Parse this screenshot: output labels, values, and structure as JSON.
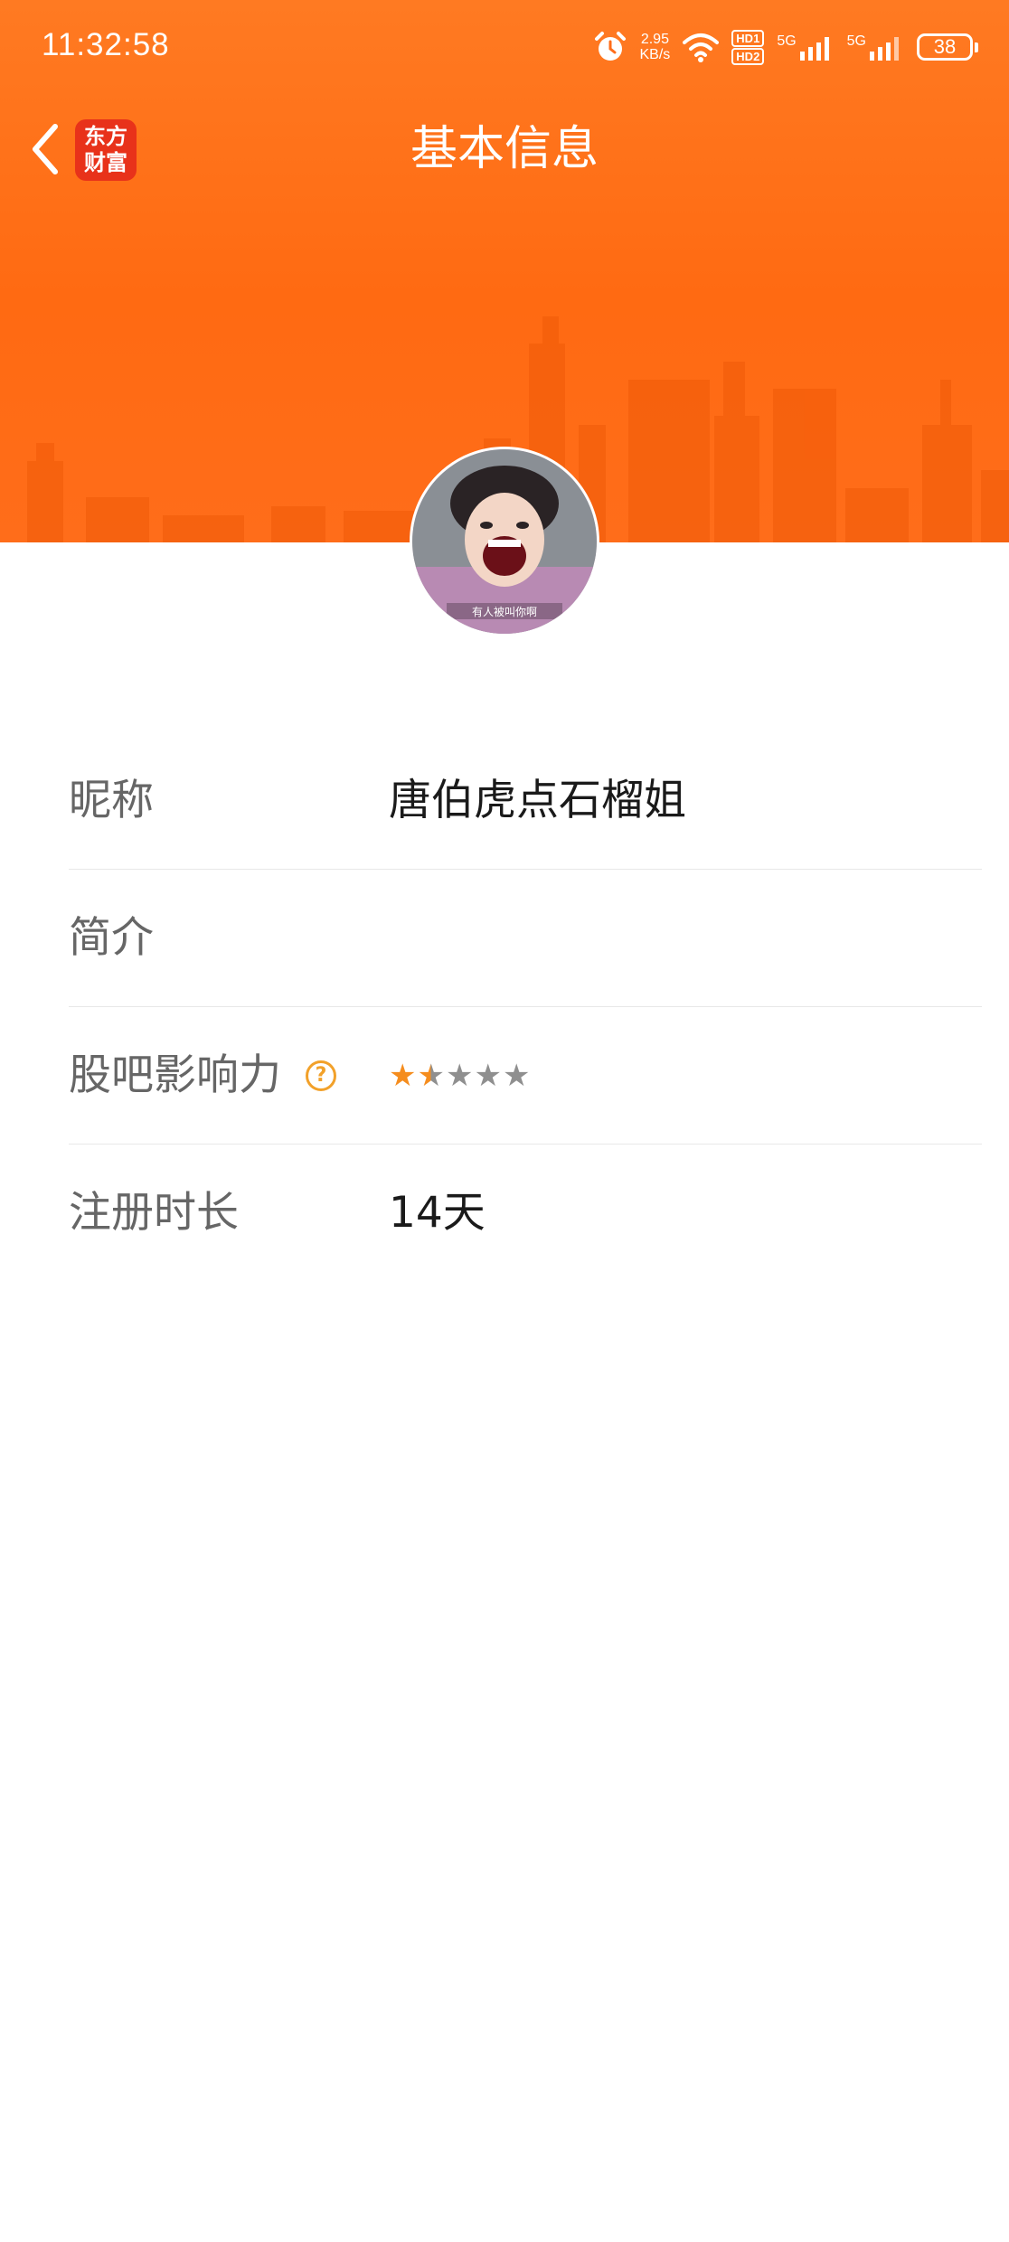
{
  "status_bar": {
    "time": "11:32:58",
    "net_speed_value": "2.95",
    "net_speed_unit": "KB/s",
    "hd_badge_top": "HD1",
    "hd_badge_bottom": "HD2",
    "sim1_label": "5G",
    "sim2_label": "5G",
    "battery_level": "38"
  },
  "nav": {
    "title": "基本信息",
    "back_icon": "chevron-left-icon",
    "logo_line1": "东方",
    "logo_line2": "财富"
  },
  "profile": {
    "avatar_caption": "有人被叫你啊"
  },
  "info": {
    "rows": [
      {
        "label": "昵称",
        "value": "唐伯虎点石榴姐"
      },
      {
        "label": "简介",
        "value": ""
      },
      {
        "label": "股吧影响力",
        "help_icon": "question-circle-icon",
        "rating": 1.5,
        "rating_max": 5
      },
      {
        "label": "注册时长",
        "value": "14天"
      }
    ]
  },
  "colors": {
    "header_orange": "#ff6d1a",
    "star_active": "#f58d1e",
    "star_inactive": "#8f8f8f",
    "help_icon": "#f2a12a",
    "logo_red": "#e8321a"
  }
}
